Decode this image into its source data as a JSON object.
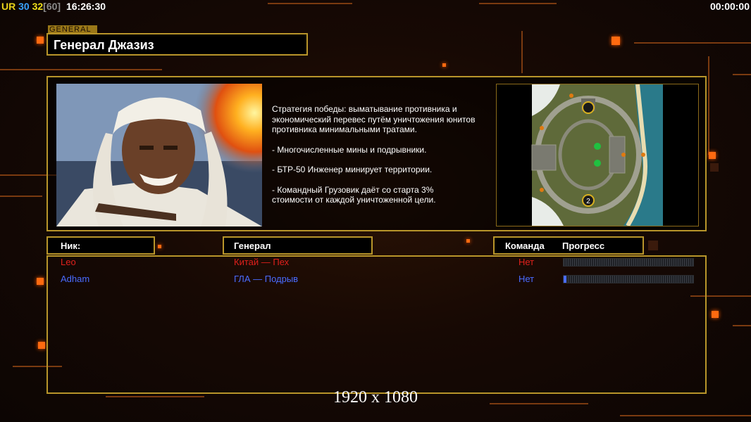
{
  "hud": {
    "ur_label": "UR",
    "fps_a": "30",
    "fps_b": "32",
    "fps_cap": "[60]",
    "clock": "16:26:30",
    "timer": "00:00:00"
  },
  "general": {
    "tag": "GENERAL",
    "name": "Генерал Джазиз",
    "description": [
      "Стратегия победы: выматывание противника и\n экономический перевес путём уничтожения юнитов\n противника минимальными тратами.",
      "- Многочисленные мины и подрывники.",
      "- БТР-50 Инженер минирует территории.",
      "- Командный Грузовик даёт со старта 3%\n  стоимости от каждой уничтоженной цели."
    ]
  },
  "map": {
    "start_positions": [
      "2"
    ]
  },
  "table": {
    "headers": {
      "nick": "Ник:",
      "general": "Генерал",
      "team": "Команда",
      "progress": "Прогресс"
    },
    "players": [
      {
        "nick": "Leo",
        "general": "Китай — Пех",
        "team": "Нет",
        "progress": 0,
        "color": "#e0201c"
      },
      {
        "nick": "Adham",
        "general": "ГЛА — Подрыв",
        "team": "Нет",
        "progress": 0.02,
        "color": "#4a6cff"
      }
    ]
  },
  "resolution_label": "1920 x 1080",
  "colors": {
    "frame": "#b8952a",
    "accent": "#ff6a10",
    "ur": "#e8d21a",
    "fps_a": "#3aa2ff",
    "fps_b": "#f0e01a",
    "fps_cap": "#8a8a8a"
  }
}
